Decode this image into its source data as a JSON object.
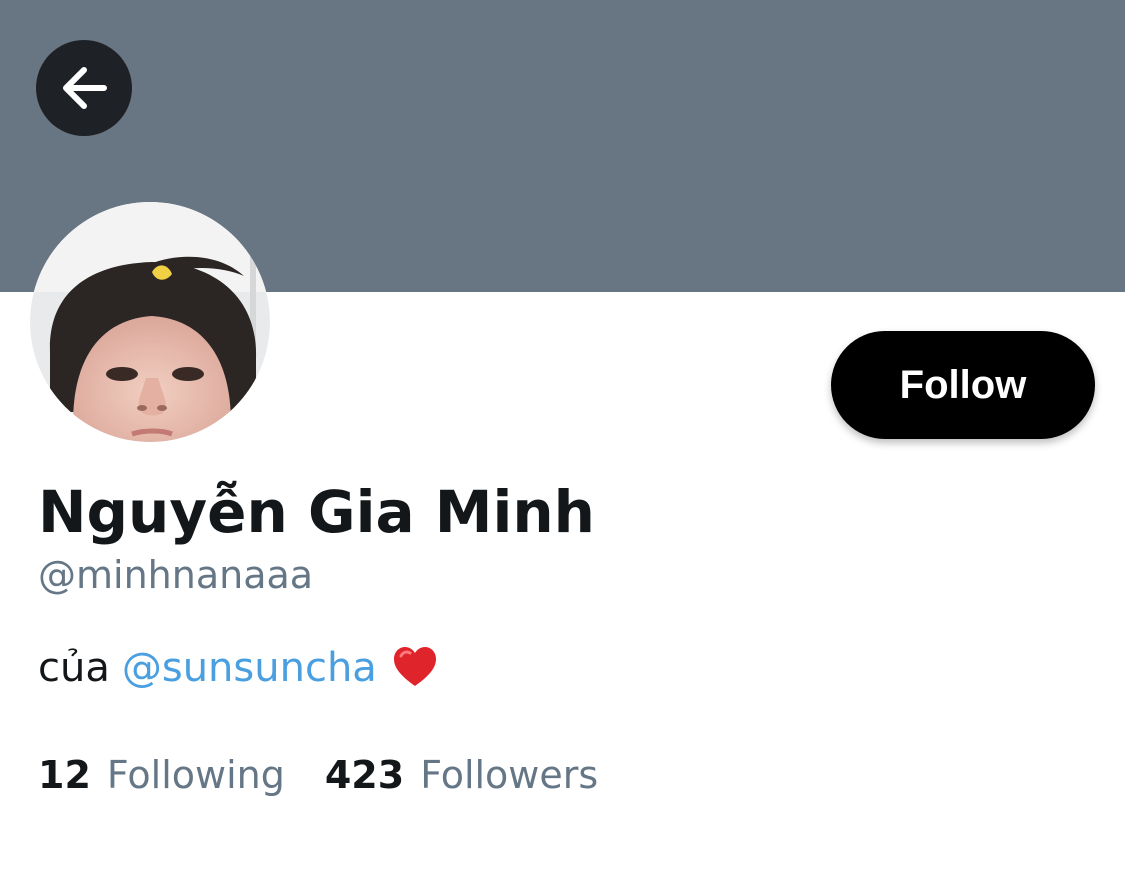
{
  "header": {
    "back_icon": "arrow-left-icon",
    "banner_color": "#687684"
  },
  "profile": {
    "display_name": "Nguyễn Gia Minh",
    "handle": "@minhnanaaa",
    "follow_label": "Follow",
    "bio": {
      "text": "của",
      "mention": "@sunsuncha",
      "emoji": "heart-emoji"
    }
  },
  "stats": {
    "following_count": "12",
    "following_label": "Following",
    "followers_count": "423",
    "followers_label": "Followers"
  },
  "colors": {
    "accent": "#4a9fe0",
    "secondary_text": "#657786",
    "primary_text": "#14171a",
    "button_bg": "#000000"
  }
}
